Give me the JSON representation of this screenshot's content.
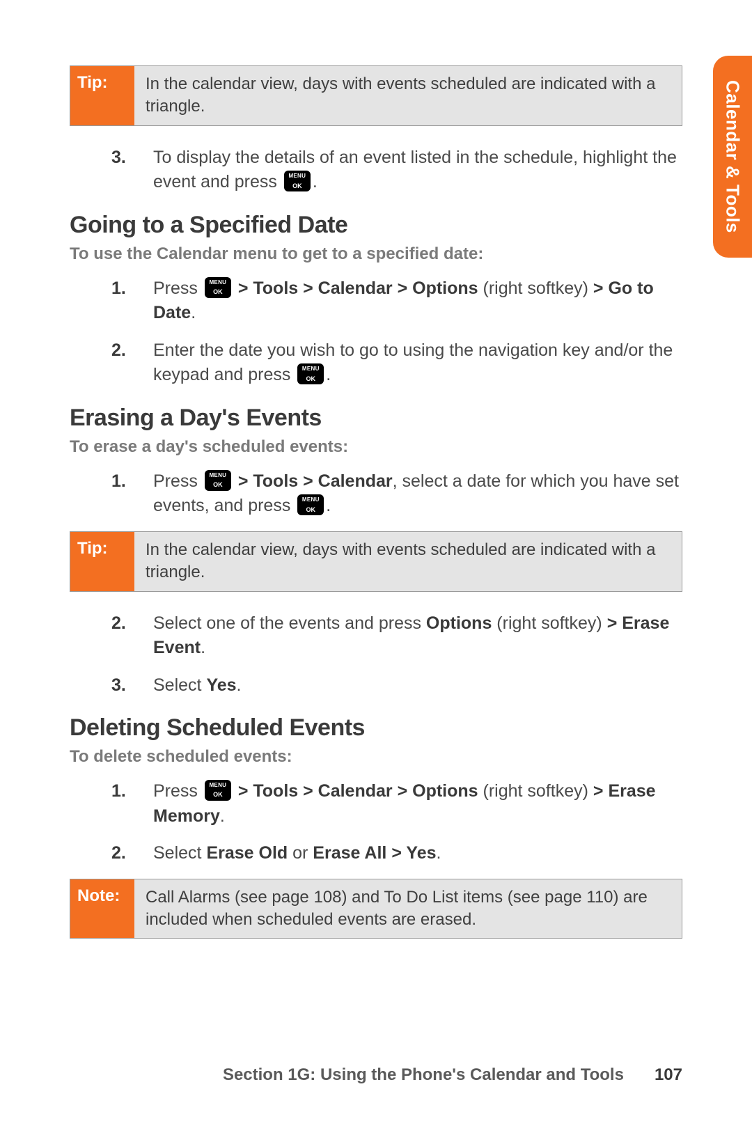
{
  "side_tab": "Calendar & Tools",
  "tip1": {
    "label": "Tip:",
    "text": "In the calendar view, days with events scheduled are indicated with a triangle."
  },
  "step3_intro": {
    "num": "3.",
    "pre": "To display the details of an event listed in the schedule, highlight the event and press ",
    "post": "."
  },
  "sec1": {
    "heading": "Going to a Specified Date",
    "sub": "To use the Calendar menu to get to a specified date:",
    "s1": {
      "num": "1.",
      "pre": "Press ",
      "path": " > Tools > Calendar > Options",
      "mid": " (right softkey) ",
      "bold2": "> Go to Date",
      "end": "."
    },
    "s2": {
      "num": "2.",
      "pre": "Enter the date you wish to go to  using the navigation key and/or the keypad and press ",
      "post": "."
    }
  },
  "sec2": {
    "heading": "Erasing a Day's Events",
    "sub": "To erase a day's scheduled events:",
    "s1": {
      "num": "1.",
      "pre": "Press ",
      "path": " > Tools > Calendar",
      "mid": ", select a date for which you have set events, and press ",
      "post": "."
    }
  },
  "tip2": {
    "label": "Tip:",
    "text": "In the calendar view, days with events scheduled are indicated with a triangle."
  },
  "sec2b": {
    "s2": {
      "num": "2.",
      "pre": "Select one of the events and press ",
      "b1": "Options",
      "mid": " (right softkey) ",
      "b2": "> Erase Event",
      "end": "."
    },
    "s3": {
      "num": "3.",
      "pre": "Select ",
      "b1": "Yes",
      "end": "."
    }
  },
  "sec3": {
    "heading": "Deleting Scheduled Events",
    "sub": "To delete scheduled events:",
    "s1": {
      "num": "1.",
      "pre": "Press ",
      "path": " > Tools > Calendar > Options",
      "mid": " (right softkey) ",
      "b2": "> Erase Memory",
      "end": "."
    },
    "s2": {
      "num": "2.",
      "pre": "Select ",
      "b1": "Erase Old",
      "mid": " or ",
      "b2": "Erase All > Yes",
      "end": "."
    }
  },
  "note": {
    "label": "Note:",
    "text": "Call Alarms (see page 108) and To Do List items (see page 110) are included when scheduled events are erased."
  },
  "footer": {
    "section": "Section 1G: Using the Phone's Calendar and Tools",
    "page": "107"
  }
}
